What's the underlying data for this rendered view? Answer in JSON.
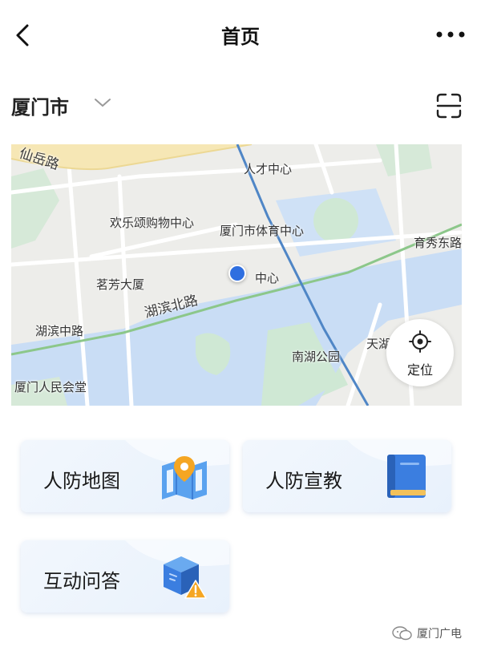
{
  "header": {
    "title": "首页",
    "back_icon": "chevron-left-icon",
    "more_icon": "more-dots-icon"
  },
  "location_bar": {
    "city": "厦门市",
    "dropdown_icon": "chevron-down-icon",
    "scan_icon": "scan-icon"
  },
  "map": {
    "labels": {
      "xianyue_road": "仙岳路",
      "rencai_center": "人才中心",
      "huanle_mall": "欢乐颂购物中心",
      "sports_center": "厦门市体育中心",
      "yuxiu_east": "育秀东路",
      "mingfang": "茗芳大厦",
      "center_partial": "中心",
      "hubin_north": "湖滨北路",
      "hubin_middle": "湖滨中路",
      "nanhu_park": "南湖公园",
      "tian_partial": "天湖",
      "people_hall": "厦门人民会堂"
    },
    "locate_button": "定位"
  },
  "cards": [
    {
      "label": "人防地图",
      "icon": "map-pin-icon"
    },
    {
      "label": "人防宣教",
      "icon": "book-icon"
    },
    {
      "label": "互动问答",
      "icon": "cube-warning-icon"
    }
  ],
  "watermark": {
    "text": "厦门广电",
    "icon": "wechat-icon"
  },
  "colors": {
    "accent": "#2f6fe0",
    "water": "#c9ddf5",
    "green_area": "#cfe8d4",
    "major_road": "#f6e7b5",
    "rail_blue": "#4f86c6",
    "rail_green": "#8cc78a"
  }
}
